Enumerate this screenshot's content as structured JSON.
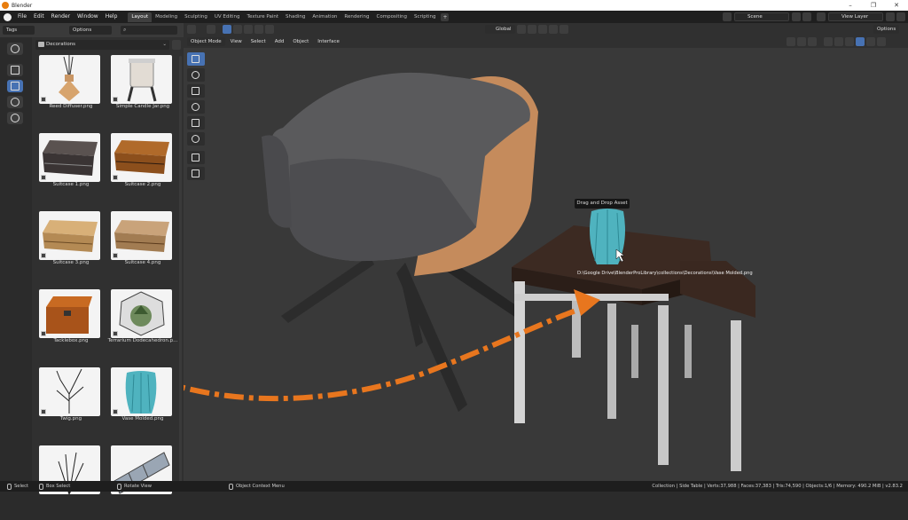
{
  "window": {
    "title": "Blender",
    "controls": [
      "–",
      "❐",
      "✕"
    ]
  },
  "menu": {
    "items": [
      "File",
      "Edit",
      "Render",
      "Window",
      "Help"
    ]
  },
  "workspaces": {
    "tabs": [
      "Layout",
      "Modeling",
      "Sculpting",
      "UV Editing",
      "Texture Paint",
      "Shading",
      "Animation",
      "Rendering",
      "Compositing",
      "Scripting"
    ],
    "active": "Layout",
    "add": "+"
  },
  "scene": {
    "label": "Scene",
    "view_layer": "View Layer"
  },
  "asset_browser": {
    "tags_label": "Tags",
    "options_label": "Options",
    "search_placeholder": "",
    "category": "Decorations",
    "assets": [
      {
        "name": "Reed Diffuser.png"
      },
      {
        "name": "Simple Candle Jar.png"
      },
      {
        "name": "Suitcase 1.png"
      },
      {
        "name": "Suitcase 2.png"
      },
      {
        "name": "Suitcase 3.png"
      },
      {
        "name": "Suitcase 4.png"
      },
      {
        "name": "Tacklebox.png"
      },
      {
        "name": "Terrarium Dodecahedron.p..."
      },
      {
        "name": "Twig.png"
      },
      {
        "name": "Vase Molded.png"
      },
      {
        "name": ""
      },
      {
        "name": ""
      }
    ]
  },
  "viewport": {
    "mode": "Object Mode",
    "menus": [
      "View",
      "Select",
      "Add",
      "Object",
      "Interface"
    ],
    "transform_orientation": "Global",
    "options_label": "Options",
    "tooltip": "Drag and Drop Asset",
    "drag_path": "D:\\Google Drive\\BlenderProLibrary\\collections\\Decorations\\Vase Molded.png"
  },
  "status": {
    "select": "Select",
    "box_select": "Box Select",
    "rotate_view": "Rotate View",
    "context_menu": "Object Context Menu",
    "stats": "Collection | Side Table | Verts:37,988 | Faces:37,383 | Tris:74,590 | Objects:1/6 | Memory: 490.2 MiB | v2.83.2"
  },
  "colors": {
    "accent": "#4772b3",
    "arrow": "#e8761e",
    "vase": "#4fb3bf"
  }
}
